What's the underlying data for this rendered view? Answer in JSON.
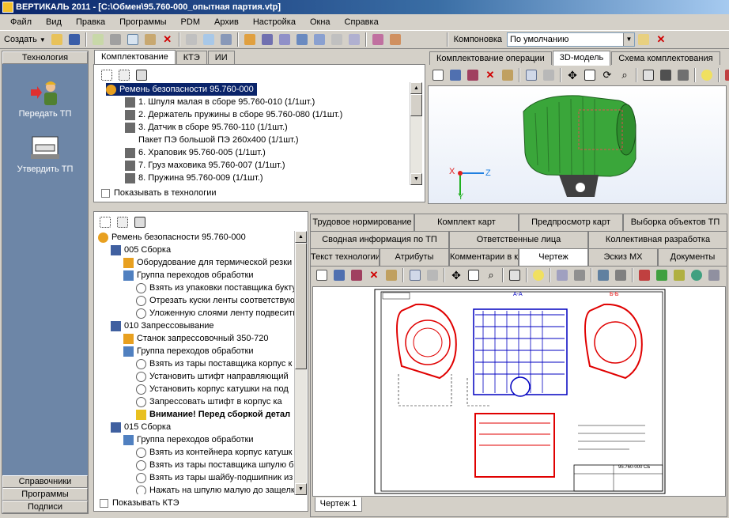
{
  "window": {
    "title": "ВЕРТИКАЛЬ 2011 - [C:\\Обмен\\95.760-000_опытная партия.vtp]"
  },
  "menu": [
    "Файл",
    "Вид",
    "Правка",
    "Программы",
    "PDM",
    "Архив",
    "Настройка",
    "Окна",
    "Справка"
  ],
  "toolbar": {
    "create_label": "Создать",
    "layout_label": "Компоновка",
    "layout_value": "По умолчанию"
  },
  "left_panel": {
    "header": "Технология",
    "items": [
      {
        "label": "Передать ТП",
        "icon": "worker-icon"
      },
      {
        "label": "Утвердить ТП",
        "icon": "approve-stamp-icon"
      }
    ],
    "bottom": [
      "Справочники",
      "Программы",
      "Подписи"
    ]
  },
  "top_tree": {
    "tabs": [
      "Комплектование",
      "КТЭ",
      "ИИ"
    ],
    "root": "Ремень безопасности 95.760-000",
    "items": [
      "1. Шпуля малая в сборе 95.760-010  (1/1шт.)",
      "2. Держатель пружины в сборе 95.760-080  (1/1шт.)",
      "3. Датчик в сборе 95.760-110  (1/1шт.)",
      "Пакет ПЭ большой ПЭ 260х400  (1/1шт.)",
      "6. Храповик 95.760-005  (1/1шт.)",
      "7. Груз маховика 95.760-007  (1/1шт.)",
      "8. Пружина 95.760-009  (1/1шт.)"
    ],
    "show_in_tech": "Показывать в технологии"
  },
  "right_top": {
    "tabs": [
      "Комплектование операции",
      "3D-модель",
      "Схема комплектования"
    ],
    "active_tab": "3D-модель",
    "axis_labels": {
      "x": "X",
      "y": "Y",
      "z": "Z"
    }
  },
  "bottom_tree": {
    "root": "Ремень безопасности 95.760-000",
    "rows": [
      {
        "level": 1,
        "text": "005 Сборка",
        "icon": "operation-icon"
      },
      {
        "level": 2,
        "text": "Оборудование для термической резки",
        "icon": "equipment-icon"
      },
      {
        "level": 2,
        "text": "Группа переходов обработки",
        "icon": "group-icon"
      },
      {
        "level": 3,
        "text": "Взять из упаковки поставщика букту",
        "icon": "step-icon"
      },
      {
        "level": 3,
        "text": "Отрезать куски ленты соответствую",
        "icon": "step-icon"
      },
      {
        "level": 3,
        "text": "Уложенную слоями ленту подвесить",
        "icon": "step-icon"
      },
      {
        "level": 1,
        "text": "010 Запрессовывание",
        "icon": "operation-icon"
      },
      {
        "level": 2,
        "text": "Станок запрессовочный 350-720",
        "icon": "equipment-icon"
      },
      {
        "level": 2,
        "text": "Группа переходов обработки",
        "icon": "group-icon"
      },
      {
        "level": 3,
        "text": "Взять из тары поставщика корпус к",
        "icon": "step-icon"
      },
      {
        "level": 3,
        "text": "Установить штифт направляющий",
        "icon": "step-icon"
      },
      {
        "level": 3,
        "text": "Установить корпус катушки на под",
        "icon": "step-icon"
      },
      {
        "level": 3,
        "text": "Запрессовать штифт в корпус ка",
        "icon": "step-icon"
      },
      {
        "level": 3,
        "text": "Внимание! Перед сборкой детал",
        "icon": "warning-icon",
        "bold": true
      },
      {
        "level": 1,
        "text": "015 Сборка",
        "icon": "operation-icon"
      },
      {
        "level": 2,
        "text": "Группа переходов обработки",
        "icon": "group-icon"
      },
      {
        "level": 3,
        "text": "Взять из контейнера корпус катушк",
        "icon": "step-icon"
      },
      {
        "level": 3,
        "text": "Взять из тары поставщика шпулю б",
        "icon": "step-icon"
      },
      {
        "level": 3,
        "text": "Взять из тары шайбу-подшипник из",
        "icon": "step-icon"
      },
      {
        "level": 3,
        "text": "Нажать на шпулю малую до защелк",
        "icon": "step-icon"
      }
    ],
    "show_kte": "Показывать КТЭ"
  },
  "right_bottom": {
    "tab_row1": [
      "Трудовое нормирование",
      "Комплект карт",
      "Предпросмотр карт",
      "Выборка объектов ТП"
    ],
    "tab_row2": [
      "Сводная информация по ТП",
      "Ответственные лица",
      "Коллективная разработка"
    ],
    "tab_row3": [
      "Текст технологии",
      "Атрибуты",
      "Комментарии в карты",
      "Чертеж",
      "Эскиз МХ",
      "Документы"
    ],
    "active_tab": "Чертеж",
    "sheet_tab": "Чертеж 1",
    "drawing_number": "95.760-000 СБ",
    "section_labels": [
      "А-А",
      "Б-Б"
    ]
  },
  "colors": {
    "selection": "#0a246a",
    "side_panel": "#6d86a7",
    "drawing_red": "#e00000",
    "drawing_blue": "#0000c0",
    "model_green": "#3aa63a"
  }
}
